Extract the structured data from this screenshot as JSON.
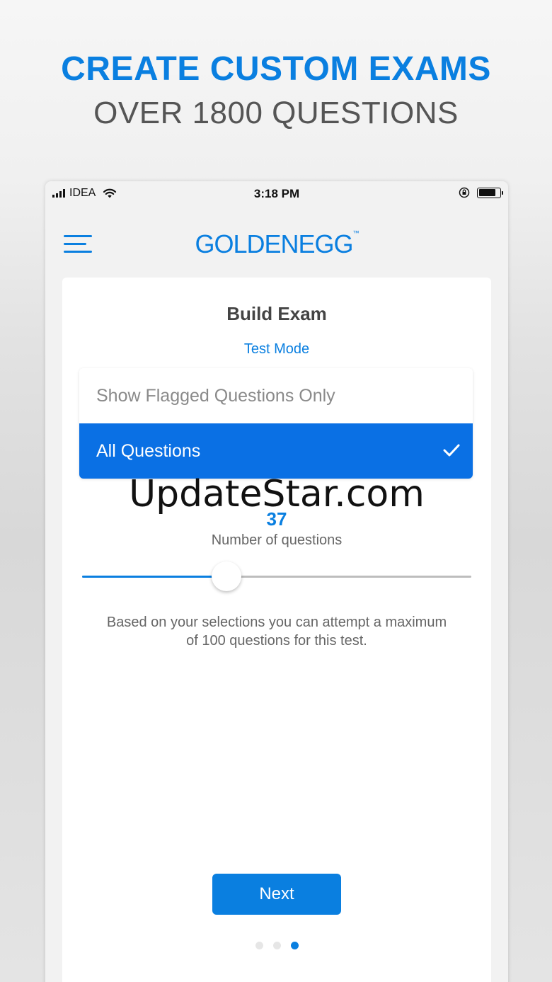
{
  "promo": {
    "headline": "CREATE CUSTOM EXAMS",
    "subheadline": "OVER 1800 QUESTIONS"
  },
  "status_bar": {
    "carrier": "IDEA",
    "time": "3:18 PM",
    "icons": [
      "signal-icon",
      "wifi-icon",
      "orientation-lock-icon",
      "battery-icon"
    ]
  },
  "header": {
    "menu_icon": "menu-icon",
    "logo_text": "GOLDENEGG",
    "logo_tm": "™"
  },
  "card": {
    "title": "Build Exam",
    "mode_link": "Test Mode",
    "dropdown": {
      "options": [
        {
          "label": "Show Flagged Questions Only",
          "selected": false
        },
        {
          "label": "All Questions",
          "selected": true
        }
      ]
    },
    "watermark": "UpdateStar.com",
    "question_count": "37",
    "question_label": "Number of questions",
    "slider": {
      "value": 37,
      "min": 0,
      "max": 100
    },
    "info_text": "Based on your selections you can attempt a maximum of 100 questions for this test.",
    "next_label": "Next",
    "pager": {
      "count": 3,
      "active": 2
    }
  },
  "colors": {
    "accent": "#0a7fe0",
    "selected_bg": "#0a70e4",
    "muted_text": "#666666"
  }
}
